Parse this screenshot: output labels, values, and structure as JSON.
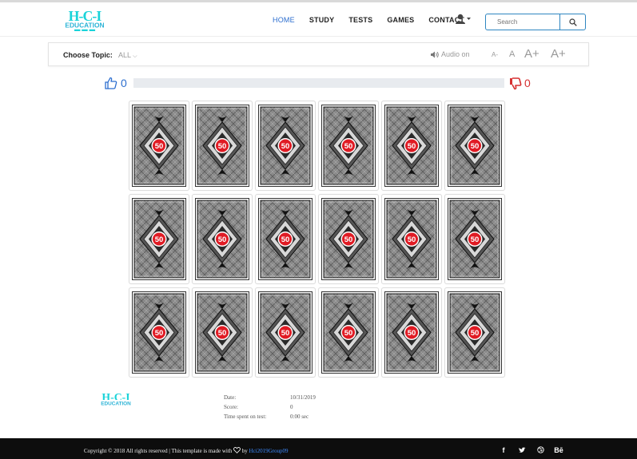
{
  "brand": {
    "logo_top": "H-C-I",
    "logo_bottom": "EDUCATION",
    "logo_color": "#19d3d9"
  },
  "nav": {
    "items": [
      {
        "label": "HOME",
        "active": true
      },
      {
        "label": "STUDY"
      },
      {
        "label": "TESTS"
      },
      {
        "label": "GAMES"
      },
      {
        "label": "CONTACT"
      }
    ],
    "user_icon": "user-dropdown-icon"
  },
  "search": {
    "placeholder": "Search",
    "icon": "search-icon"
  },
  "topic": {
    "label": "Choose Topic:",
    "value": "ALL"
  },
  "audio": {
    "label": "Audio on",
    "icon": "speaker-icon"
  },
  "font_size": {
    "options": [
      "A-",
      "A",
      "A+",
      "A+"
    ]
  },
  "score": {
    "correct": "0",
    "wrong": "0",
    "progress": 0,
    "correct_color": "#2c6ecf",
    "wrong_color": "#d63031"
  },
  "cards": {
    "count": 18,
    "badge": "50",
    "badge_color": "#e01b24"
  },
  "results": {
    "rows": [
      {
        "key": "Date:",
        "value": "10/31/2019"
      },
      {
        "key": "Score:",
        "value": "0"
      },
      {
        "key": "Time spent on test:",
        "value": "0:00 sec"
      }
    ]
  },
  "footer": {
    "copyright": "Copyright © 2018 All rights reserved | This template is made with",
    "by": "by",
    "author": "Hci2019Group09",
    "socials": [
      "f",
      "twitter",
      "dribbble",
      "Bē"
    ]
  }
}
